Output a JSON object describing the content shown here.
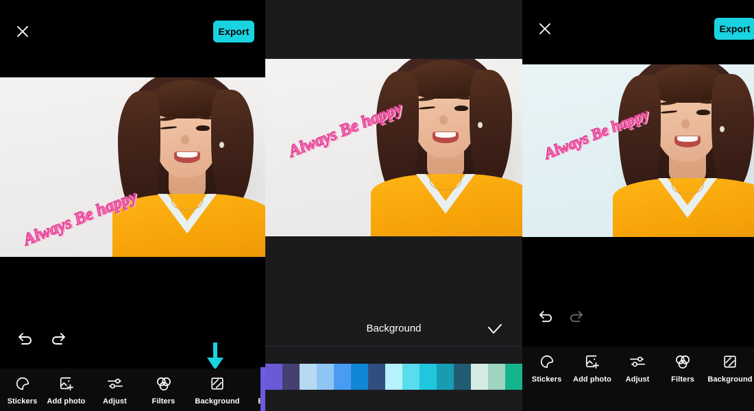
{
  "app": {
    "name": "photo-editor",
    "accent_cyan": "#19d3e0",
    "toolbar_bg": "#0c0c0d",
    "sheet_bg": "#1b1b1d",
    "sticker_pink": "#f06ab0"
  },
  "sticker": {
    "text": "Always Be happy"
  },
  "panels": [
    {
      "id": "left",
      "topbar": {
        "close_icon": "close-icon",
        "export_label": "Export"
      },
      "canvas": {
        "background_label": "white",
        "background_color": "#efeeec"
      },
      "undo_redo": {
        "undo_icon": "undo-icon",
        "redo_icon": "redo-icon",
        "undo_enabled": true,
        "redo_enabled": true
      },
      "toolbar": [
        {
          "icon": "sticker-icon",
          "label": "Stickers"
        },
        {
          "icon": "add-photo-icon",
          "label": "Add photo"
        },
        {
          "icon": "adjust-icon",
          "label": "Adjust"
        },
        {
          "icon": "filters-icon",
          "label": "Filters"
        },
        {
          "icon": "background-icon",
          "label": "Background"
        },
        {
          "icon": "edit-image-icon",
          "label": "Edit i"
        }
      ],
      "annotation": {
        "type": "down-arrow",
        "color": "#19d3e0",
        "points_to": "Background"
      }
    },
    {
      "id": "middle",
      "canvas": {
        "background_label": "white",
        "background_color": "#efeeec"
      },
      "undo_redo": {
        "undo_icon": "undo-icon",
        "redo_icon": "redo-icon",
        "undo_enabled": true,
        "redo_enabled": true
      },
      "sheet": {
        "title": "Background",
        "confirm_icon": "checkmark-icon",
        "swatches": [
          "#6a5ad8",
          "#454072",
          "#b6daf2",
          "#8fc5f5",
          "#4a9bf2",
          "#0f86d6",
          "#324e81",
          "#b6f2fb",
          "#59dced",
          "#20c6dd",
          "#189cb2",
          "#215d72",
          "#d5ece3",
          "#9fd4c0",
          "#16b48e"
        ]
      }
    },
    {
      "id": "right",
      "topbar": {
        "close_icon": "close-icon",
        "export_label": "Export"
      },
      "canvas": {
        "background_label": "light-cyan",
        "background_color": "#e2f0f3"
      },
      "undo_redo": {
        "undo_icon": "undo-icon",
        "redo_icon": "redo-icon",
        "undo_enabled": true,
        "redo_enabled": false
      },
      "toolbar": [
        {
          "icon": "sticker-icon",
          "label": "Stickers"
        },
        {
          "icon": "add-photo-icon",
          "label": "Add photo"
        },
        {
          "icon": "adjust-icon",
          "label": "Adjust"
        },
        {
          "icon": "filters-icon",
          "label": "Filters"
        },
        {
          "icon": "background-icon",
          "label": "Background"
        }
      ]
    }
  ]
}
